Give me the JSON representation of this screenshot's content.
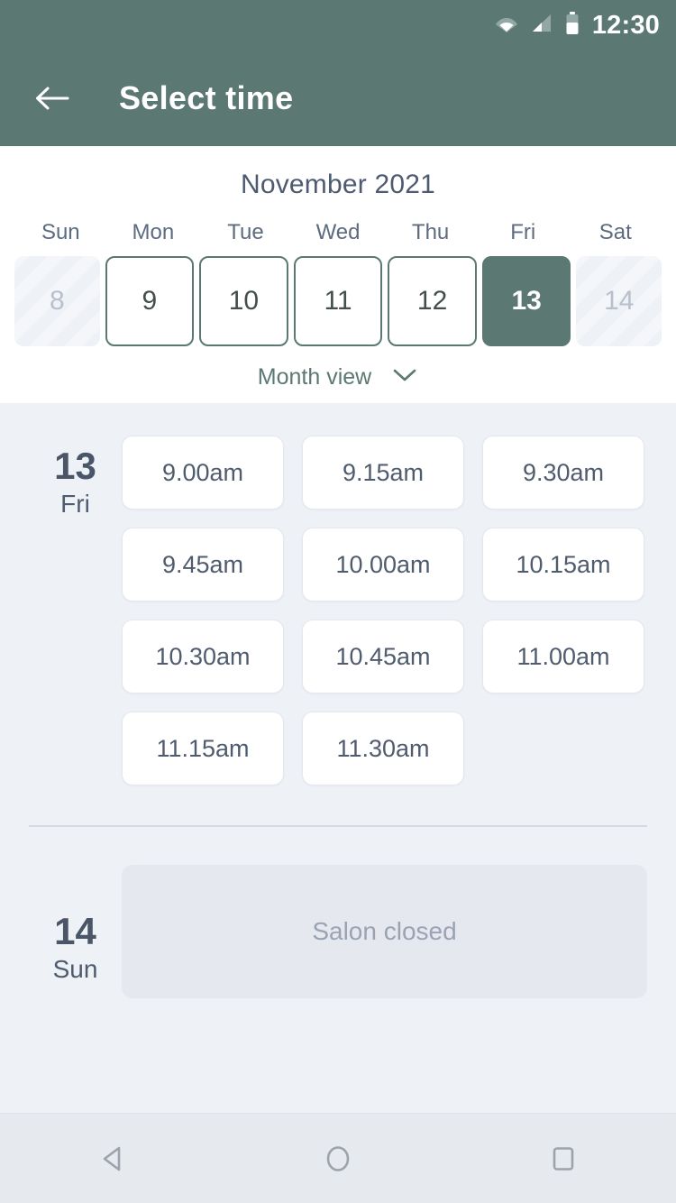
{
  "status_bar": {
    "time": "12:30",
    "icons": [
      "wifi-icon",
      "cellular-signal-icon",
      "battery-icon"
    ]
  },
  "app_bar": {
    "back_icon": "arrow-left-icon",
    "title": "Select time"
  },
  "calendar": {
    "month_label": "November 2021",
    "weekdays": [
      "Sun",
      "Mon",
      "Tue",
      "Wed",
      "Thu",
      "Fri",
      "Sat"
    ],
    "days": [
      {
        "num": "8",
        "state": "disabled"
      },
      {
        "num": "9",
        "state": "available"
      },
      {
        "num": "10",
        "state": "available"
      },
      {
        "num": "11",
        "state": "available"
      },
      {
        "num": "12",
        "state": "available"
      },
      {
        "num": "13",
        "state": "selected"
      },
      {
        "num": "14",
        "state": "disabled"
      }
    ],
    "view_toggle_label": "Month view",
    "view_toggle_icon": "chevron-down-icon"
  },
  "schedule": {
    "open_day": {
      "day_num": "13",
      "day_of_week": "Fri",
      "slots": [
        "9.00am",
        "9.15am",
        "9.30am",
        "9.45am",
        "10.00am",
        "10.15am",
        "10.30am",
        "10.45am",
        "11.00am",
        "11.15am",
        "11.30am"
      ]
    },
    "closed_day": {
      "day_num": "14",
      "day_of_week": "Sun",
      "message": "Salon closed"
    }
  },
  "nav_bar": {
    "back": "triangle-back-icon",
    "home": "circle-home-icon",
    "recents": "square-recents-icon"
  },
  "colors": {
    "brand_teal": "#5b7873",
    "page_bg": "#eef1f6",
    "text_dark": "#4a5568",
    "text_muted": "#9aa3b4"
  }
}
